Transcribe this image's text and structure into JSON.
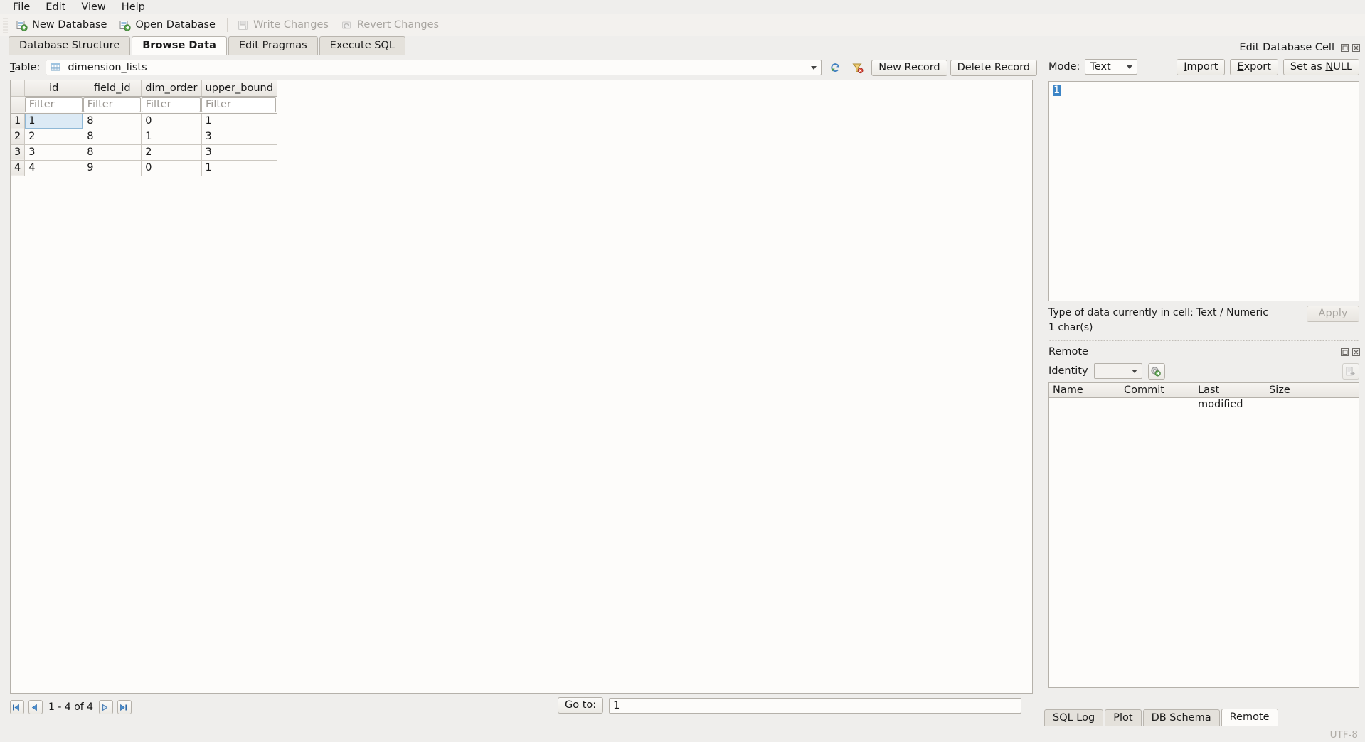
{
  "menubar": {
    "items": [
      {
        "label": "File",
        "mnemonic": "F"
      },
      {
        "label": "Edit",
        "mnemonic": "E"
      },
      {
        "label": "View",
        "mnemonic": "V"
      },
      {
        "label": "Help",
        "mnemonic": "H"
      }
    ]
  },
  "toolbar": {
    "new_database": "New Database",
    "open_database": "Open Database",
    "write_changes": "Write Changes",
    "revert_changes": "Revert Changes"
  },
  "main_tabs": [
    {
      "label": "Database Structure",
      "active": false
    },
    {
      "label": "Browse Data",
      "active": true
    },
    {
      "label": "Edit Pragmas",
      "active": false
    },
    {
      "label": "Execute SQL",
      "active": false
    }
  ],
  "browse": {
    "table_label": "Table:",
    "table_label_mnemonic": "T",
    "selected_table": "dimension_lists",
    "refresh_icon": "refresh-icon",
    "clear_filters_icon": "clear-filters-icon",
    "new_record_button": "New Record",
    "delete_record_button": "Delete Record",
    "columns": [
      "id",
      "field_id",
      "dim_order",
      "upper_bound"
    ],
    "filter_placeholder": "Filter",
    "rows": [
      {
        "num": "1",
        "cells": [
          "1",
          "8",
          "0",
          "1"
        ]
      },
      {
        "num": "2",
        "cells": [
          "2",
          "8",
          "1",
          "3"
        ]
      },
      {
        "num": "3",
        "cells": [
          "3",
          "8",
          "2",
          "3"
        ]
      },
      {
        "num": "4",
        "cells": [
          "4",
          "9",
          "0",
          "1"
        ]
      }
    ],
    "selected_cell": {
      "row": 0,
      "col": 0,
      "value": "1"
    }
  },
  "navbar": {
    "first_icon": "first-page-icon",
    "prev_icon": "previous-page-icon",
    "range_text": "1 - 4 of 4",
    "next_icon": "next-page-icon",
    "last_icon": "last-page-icon",
    "goto_button": "Go to:",
    "goto_value": "1"
  },
  "edit_cell_panel": {
    "title": "Edit Database Cell",
    "float_icon": "float-dock-icon",
    "close_icon": "close-dock-icon",
    "mode_label": "Mode:",
    "mode_value": "Text",
    "import_button": "Import",
    "import_mnemonic": "I",
    "export_button": "Export",
    "export_mnemonic": "E",
    "set_null_button": "Set as NULL",
    "set_null_mnemonic": "N",
    "editor_value": "1",
    "type_line": "Type of data currently in cell: Text / Numeric",
    "chars_line": "1 char(s)",
    "apply_button": "Apply"
  },
  "remote_panel": {
    "title": "Remote",
    "float_icon": "float-dock-icon",
    "close_icon": "close-dock-icon",
    "identity_label": "Identity",
    "identity_value": "",
    "settings_icon": "remote-settings-icon",
    "push_icon": "push-to-remote-icon",
    "columns": [
      "Name",
      "Commit",
      "Last modified",
      "Size"
    ],
    "rows": []
  },
  "bottom_tabs": [
    {
      "label": "SQL Log",
      "active": false
    },
    {
      "label": "Plot",
      "active": false
    },
    {
      "label": "DB Schema",
      "active": false
    },
    {
      "label": "Remote",
      "active": true
    }
  ],
  "statusbar": {
    "encoding": "UTF-8"
  },
  "colors": {
    "window_bg": "#efeeec",
    "panel_bg": "#fdfcfa",
    "selection_blue": "#3d85c6",
    "cell_select_bg": "#dceaf5",
    "border": "#b5b1aa",
    "disabled_text": "#a9a6a1"
  }
}
